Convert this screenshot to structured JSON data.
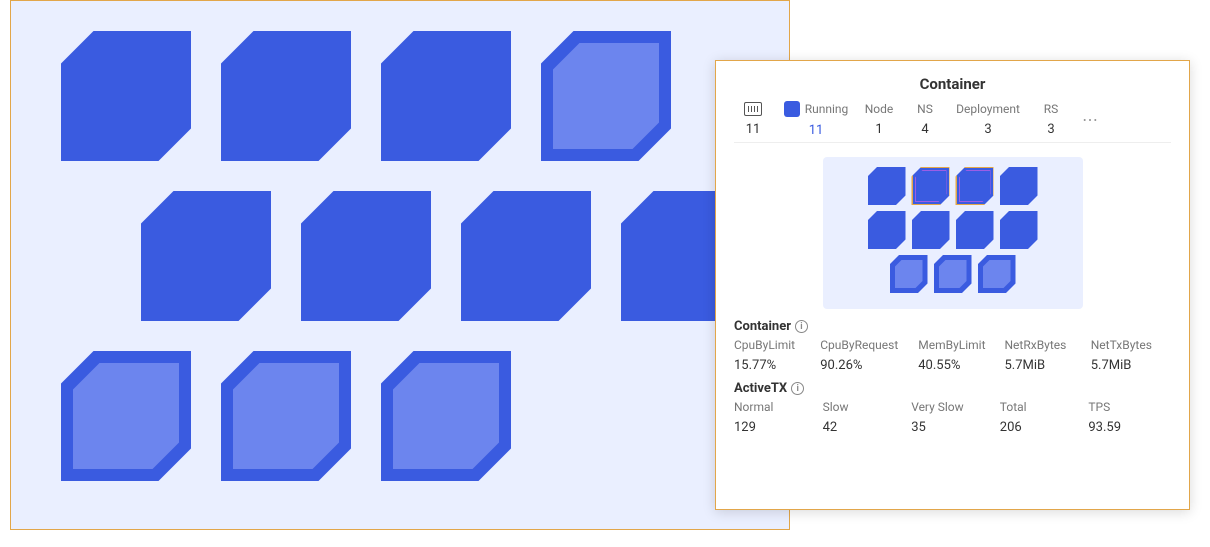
{
  "detail": {
    "title": "Container",
    "summary": {
      "total_label": "",
      "total_value": "11",
      "running_label": "Running",
      "running_value": "11",
      "node_label": "Node",
      "node_value": "1",
      "ns_label": "NS",
      "ns_value": "4",
      "deployment_label": "Deployment",
      "deployment_value": "3",
      "rs_label": "RS",
      "rs_value": "3"
    },
    "container_metrics": {
      "title": "Container",
      "cols": [
        {
          "label": "CpuByLimit",
          "value": "15.77%"
        },
        {
          "label": "CpuByRequest",
          "value": "90.26%"
        },
        {
          "label": "MemByLimit",
          "value": "40.55%"
        },
        {
          "label": "NetRxBytes",
          "value": "5.7MiB"
        },
        {
          "label": "NetTxBytes",
          "value": "5.7MiB"
        }
      ]
    },
    "activetx_metrics": {
      "title": "ActiveTX",
      "cols": [
        {
          "label": "Normal",
          "value": "129"
        },
        {
          "label": "Slow",
          "value": "42"
        },
        {
          "label": "Very Slow",
          "value": "35"
        },
        {
          "label": "Total",
          "value": "206"
        },
        {
          "label": "TPS",
          "value": "93.59"
        }
      ]
    }
  }
}
